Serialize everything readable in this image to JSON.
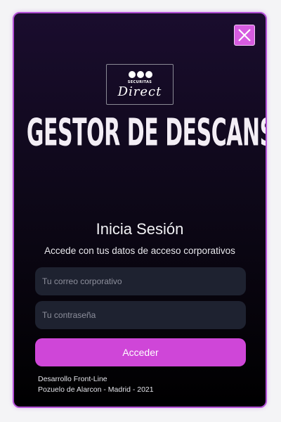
{
  "dialog": {
    "close_icon": "close-icon",
    "accent_color": "#cf46d8",
    "background_color": "#0e0819"
  },
  "logo": {
    "brand_small": "SECURITAS",
    "brand_script": "Direct"
  },
  "app_title": "GESTOR DE DESCANSOS",
  "login": {
    "heading": "Inicia Sesión",
    "subheading": "Accede con tus datos de acceso corporativos",
    "email_placeholder": "Tu correo corporativo",
    "email_value": "",
    "password_placeholder": "Tu contraseña",
    "password_value": "",
    "submit_label": "Acceder"
  },
  "footer": {
    "line1": "Desarrollo Front-Line",
    "line2": "Pozuelo de Alarcon - Madrid - 2021"
  }
}
